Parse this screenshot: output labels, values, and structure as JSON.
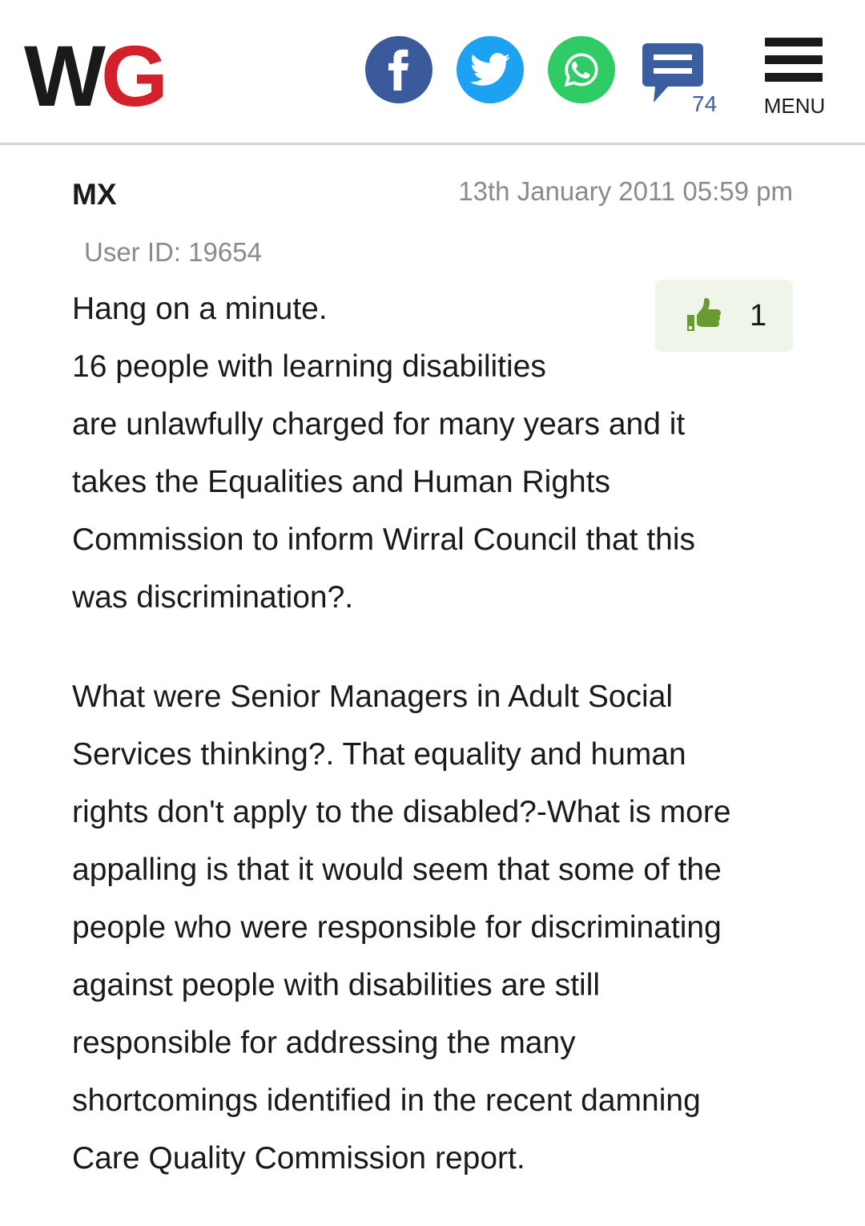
{
  "header": {
    "logo": {
      "w": "W",
      "g": "G"
    },
    "comment_count": "74",
    "menu_label": "MENU",
    "share": {
      "facebook_icon": "facebook-icon",
      "twitter_icon": "twitter-icon",
      "whatsapp_icon": "whatsapp-icon"
    }
  },
  "comment": {
    "author": "MX",
    "timestamp": "13th January 2011 05:59 pm",
    "user_id": "User ID: 19654",
    "likes": "1",
    "paragraphs": [
      {
        "lines": [
          "Hang on a minute.",
          "16 people with learning disabilities",
          "are unlawfully charged for many years and it",
          "takes the Equalities and Human Rights",
          "Commission to inform Wirral Council that this",
          "was discrimination?."
        ]
      },
      {
        "lines": [
          "What were Senior Managers in Adult Social",
          "Services thinking?. That equality and human",
          "rights don't apply to the disabled?-What is more",
          "appalling is that it would seem that some of the",
          "people who were responsible for discriminating",
          "against people with disabilities are still",
          "responsible for addressing the many",
          "shortcomings identified in the recent damning",
          "Care Quality Commission report."
        ]
      }
    ]
  },
  "colors": {
    "brand_red": "#d4202a",
    "facebook": "#3b5a9b",
    "twitter": "#1da1f2",
    "whatsapp": "#2fcc66",
    "comment_blue": "#3a5ea0",
    "like_green": "#6a9a32"
  }
}
